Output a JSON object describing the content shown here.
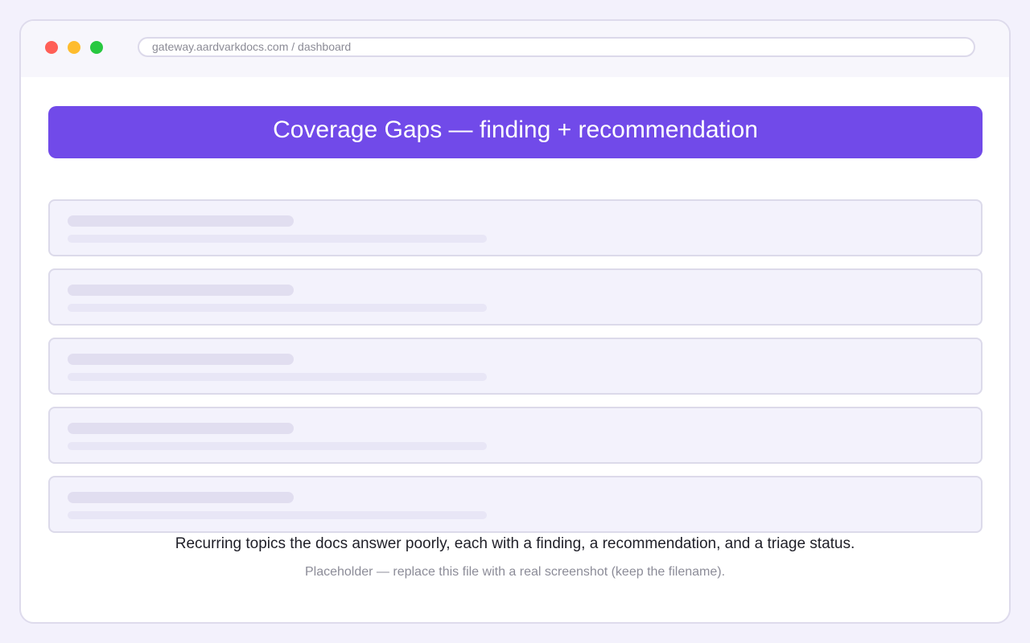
{
  "browser": {
    "url": "gateway.aardvarkdocs.com / dashboard"
  },
  "page": {
    "banner_title": "Coverage Gaps — finding + recommendation",
    "caption": "Recurring topics the docs answer poorly, each with a finding, a recommendation, and a triage status.",
    "placeholder_note": "Placeholder — replace this file with a real screenshot (keep the filename)."
  },
  "cards": [
    {
      "kind": "skeleton"
    },
    {
      "kind": "skeleton"
    },
    {
      "kind": "skeleton"
    },
    {
      "kind": "skeleton"
    },
    {
      "kind": "skeleton"
    }
  ],
  "colors": {
    "accent": "#714ae9",
    "page_background": "#f3f1fc",
    "card_background": "#f3f2fc",
    "window_close": "#ff5f57",
    "window_minimize": "#febc2e",
    "window_maximize": "#28c840"
  }
}
